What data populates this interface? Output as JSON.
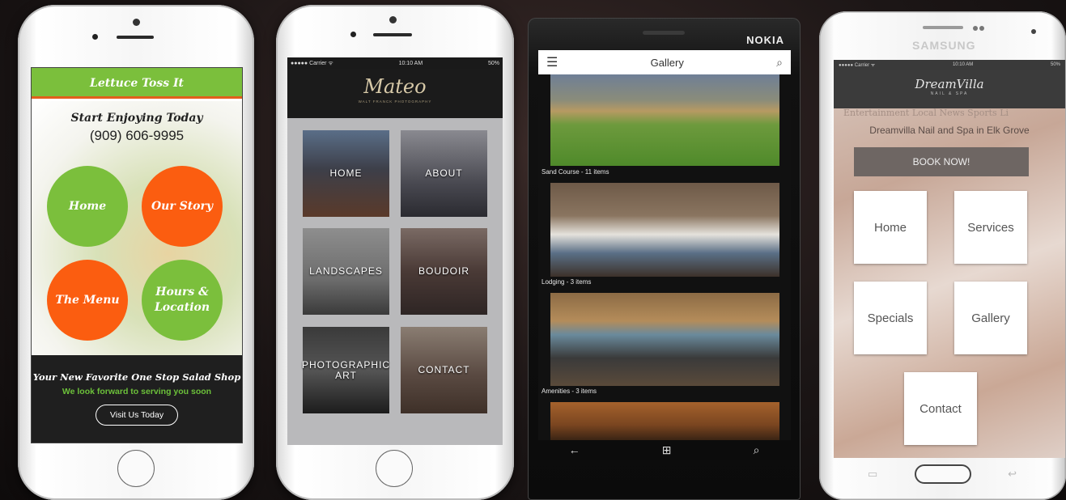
{
  "phone1": {
    "app_title": "Lettuce Toss It",
    "tagline": "Start Enjoying Today",
    "phone_number": "(909) 606-9995",
    "buttons": [
      "Home",
      "Our Story",
      "The Menu",
      "Hours & Location"
    ],
    "footer_heading": "Your New Favorite One Stop Salad Shop",
    "footer_sub": "We look forward to serving you soon",
    "cta_label": "Visit Us Today",
    "colors": {
      "green": "#7bbf3c",
      "orange": "#fb5d10"
    }
  },
  "phone2": {
    "status": {
      "carrier": "●●●●● Carrier ᯤ",
      "time": "10:10 AM",
      "battery": "50%"
    },
    "logo": "Mateo",
    "logo_sub": "WALT FRANCK PHOTOGRAPHY",
    "tiles": [
      "HOME",
      "ABOUT",
      "LANDSCAPES",
      "BOUDOIR",
      "PHOTOGRAPHIC ART",
      "CONTACT"
    ]
  },
  "phone3": {
    "brand": "NOKIA",
    "screen_title": "Gallery",
    "gallery": [
      {
        "caption": "Sand Course  - 11 items"
      },
      {
        "caption": "Lodging  - 3 items"
      },
      {
        "caption": "Amenities  - 3 items"
      }
    ],
    "nav": {
      "back": "←",
      "home": "⊞",
      "search": "⌕"
    }
  },
  "phone4": {
    "brand": "SAMSUNG",
    "status": {
      "carrier": "●●●●● Carrier ᯤ",
      "time": "10:10 AM",
      "battery": "50%"
    },
    "logo": "DreamVilla",
    "logo_sub": "NAIL & SPA",
    "tabs": "Entertainment    Local News    Sports    Li",
    "tagline": "Dreamvilla Nail and Spa in Elk Grove",
    "book_label": "BOOK NOW!",
    "tiles": [
      "Home",
      "Services",
      "Specials",
      "Gallery",
      "Contact"
    ]
  }
}
